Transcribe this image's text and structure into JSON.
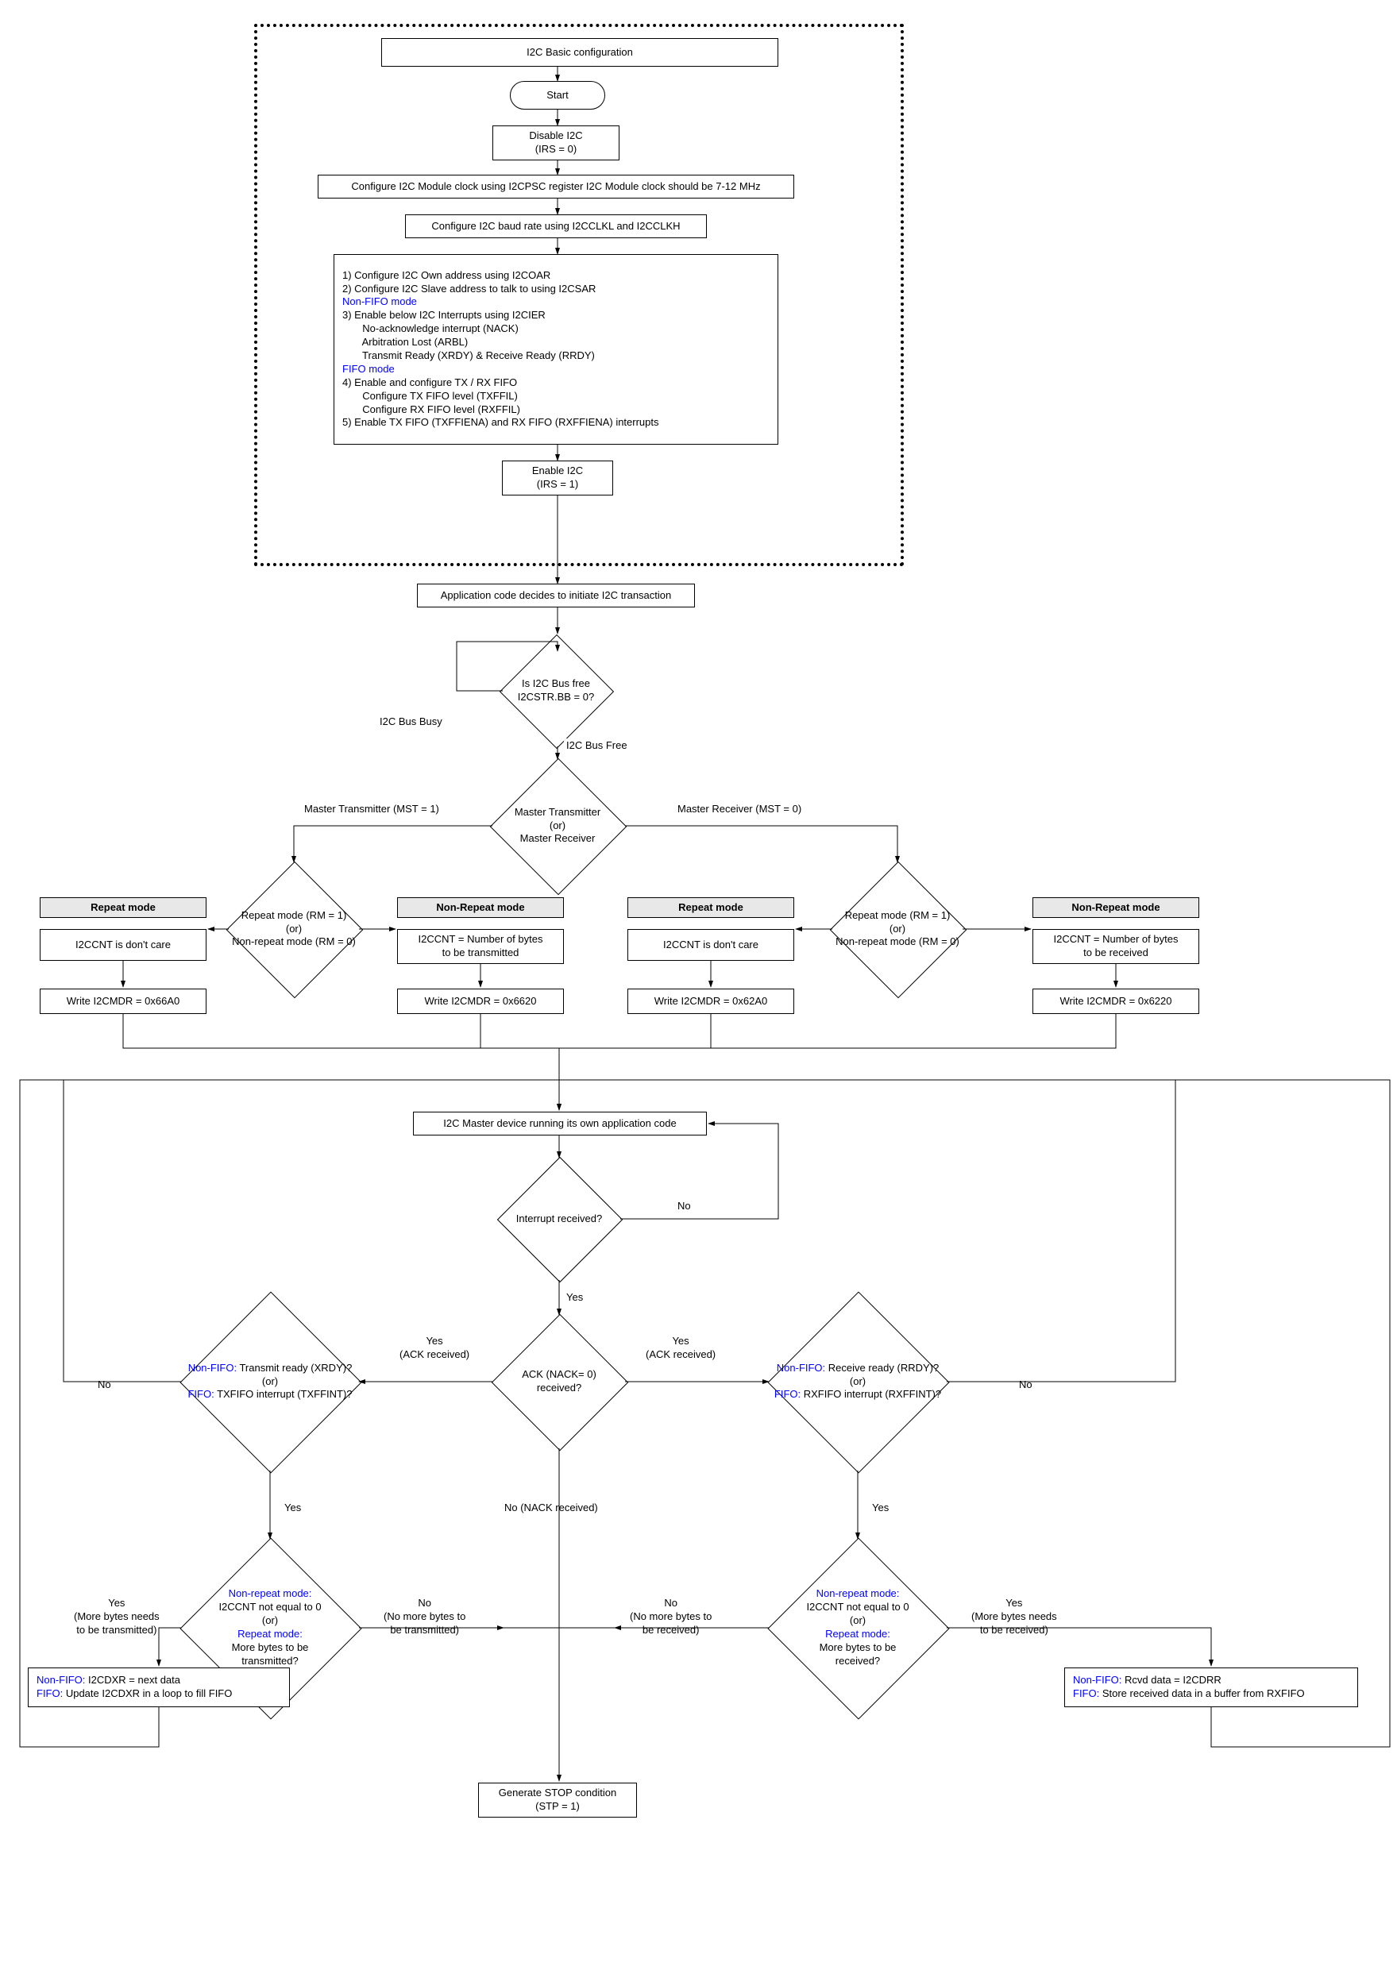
{
  "title": "I2C Basic configuration",
  "start": "Start",
  "disable_i2c": "Disable I2C\n(IRS = 0)",
  "config_clock": "Configure I2C Module clock using I2CPSC register I2C Module clock should be 7-12 MHz",
  "config_baud": "Configure I2C baud rate using I2CCLKL and I2CCLKH",
  "config_block": {
    "l1": "1) Configure I2C Own address using I2COAR",
    "l2": "2) Configure I2C Slave address to talk to using I2CSAR",
    "nf": "Non-FIFO mode",
    "l3": "3) Enable below I2C Interrupts using I2CIER",
    "l3a": "       No-acknowledge interrupt (NACK)",
    "l3b": "       Arbitration Lost (ARBL)",
    "l3c": "       Transmit Ready (XRDY) & Receive Ready (RRDY)",
    "ff": "FIFO mode",
    "l4": "4) Enable and configure TX / RX FIFO",
    "l4a": "       Configure TX FIFO level (TXFFIL)",
    "l4b": "       Configure RX FIFO level (RXFFIL)",
    "l5": "5) Enable TX FIFO (TXFFIENA) and RX FIFO (RXFFIENA) interrupts"
  },
  "enable_i2c": "Enable I2C\n(IRS = 1)",
  "app_decides": "Application code decides to  initiate I2C transaction",
  "bus_free_q": "Is I2C Bus free\nI2CSTR.BB = 0?",
  "bus_busy": "I2C Bus Busy",
  "bus_free": "I2C Bus Free",
  "mst_q": "Master Transmitter\n(or)\nMaster Receiver",
  "mst_tx": "Master Transmitter (MST = 1)",
  "mst_rx": "Master Receiver (MST = 0)",
  "rm_q": "Repeat mode (RM = 1)\n(or)\nNon-repeat mode (RM = 0)",
  "repeat_hdr": "Repeat mode",
  "nonrepeat_hdr": "Non-Repeat mode",
  "i2ccnt_dc": "I2CCNT is don't care",
  "i2ccnt_tx": "I2CCNT = Number of bytes\nto be transmitted",
  "i2ccnt_rx": "I2CCNT = Number of bytes\nto be received",
  "mdr_66A0": "Write I2CMDR = 0x66A0",
  "mdr_6620": "Write I2CMDR = 0x6620",
  "mdr_62A0": "Write I2CMDR = 0x62A0",
  "mdr_6220": "Write I2CMDR = 0x6220",
  "master_running": "I2C Master device running its own application code",
  "irq_q": "Interrupt received?",
  "no": "No",
  "yes": "Yes",
  "ack_q": "ACK (NACK= 0)\nreceived?",
  "yes_ack": "Yes\n(ACK received)",
  "no_nack": "No (NACK received)",
  "xrdy_q_nf": "Non-FIFO:",
  "xrdy_q_nf2": " Transmit ready (XRDY)?",
  "or": "(or)",
  "xrdy_q_ff": "FIFO:",
  "xrdy_q_ff2": " TXFIFO interrupt (TXFFINT)?",
  "rrdy_q_nf2": " Receive ready (RRDY)?",
  "rrdy_q_ff2": " RXFIFO interrupt (RXFFINT)?",
  "more_tx_nr": "Non-repeat mode:",
  "more_tx_nr2": "I2CCNT not equal to 0",
  "more_tx_rm": "Repeat mode:",
  "more_tx_rm2": "More bytes to be\ntransmitted?",
  "more_rx_rm2": "More bytes to be\nreceived?",
  "yes_more_tx": "Yes\n(More bytes needs\nto be transmitted)",
  "no_more_tx": "No\n(No more bytes to\nbe transmitted)",
  "yes_more_rx": "Yes\n(More bytes needs\nto be received)",
  "no_more_rx": "No\n(No more bytes to\nbe received)",
  "tx_action_nf": "Non-FIFO:",
  "tx_action_nf2": " I2CDXR = next data",
  "tx_action_ff": "FIFO:",
  "tx_action_ff2": " Update I2CDXR in a loop to fill FIFO",
  "rx_action_nf2": " Rcvd data = I2CDRR",
  "rx_action_ff2": " Store received data in a buffer from RXFIFO",
  "stop": "Generate STOP condition\n(STP = 1)",
  "chart_data": {
    "type": "flowchart",
    "nodes": [
      {
        "id": "title",
        "type": "process",
        "label": "I2C Basic configuration"
      },
      {
        "id": "start",
        "type": "terminator",
        "label": "Start"
      },
      {
        "id": "disable",
        "type": "process",
        "label": "Disable I2C (IRS = 0)"
      },
      {
        "id": "cfg_clock",
        "type": "process",
        "label": "Configure I2C Module clock using I2CPSC register I2C Module clock should be 7-12 MHz"
      },
      {
        "id": "cfg_baud",
        "type": "process",
        "label": "Configure I2C baud rate using I2CCLKL and I2CCLKH"
      },
      {
        "id": "cfg_block",
        "type": "process",
        "label": "1) Configure I2C Own address using I2COAR; 2) Configure I2C Slave address using I2CSAR; Non-FIFO mode: 3) Enable I2C Interrupts using I2CIER (NACK, ARBL, XRDY & RRDY); FIFO mode: 4) Enable and configure TX/RX FIFO (TXFFIL, RXFFIL); 5) Enable TX FIFO (TXFFIENA) and RX FIFO (RXFFIENA) interrupts"
      },
      {
        "id": "enable",
        "type": "process",
        "label": "Enable I2C (IRS = 1)"
      },
      {
        "id": "app",
        "type": "process",
        "label": "Application code decides to initiate I2C transaction"
      },
      {
        "id": "busfree",
        "type": "decision",
        "label": "Is I2C Bus free I2CSTR.BB = 0?"
      },
      {
        "id": "mst",
        "type": "decision",
        "label": "Master Transmitter (or) Master Receiver"
      },
      {
        "id": "rm_tx",
        "type": "decision",
        "label": "Repeat mode (RM = 1) (or) Non-repeat mode (RM = 0)"
      },
      {
        "id": "rm_rx",
        "type": "decision",
        "label": "Repeat mode (RM = 1) (or) Non-repeat mode (RM = 0)"
      },
      {
        "id": "tx_rep_cnt",
        "type": "process",
        "label": "I2CCNT is don't care"
      },
      {
        "id": "tx_nrep_cnt",
        "type": "process",
        "label": "I2CCNT = Number of bytes to be transmitted"
      },
      {
        "id": "rx_rep_cnt",
        "type": "process",
        "label": "I2CCNT is don't care"
      },
      {
        "id": "rx_nrep_cnt",
        "type": "process",
        "label": "I2CCNT = Number of bytes to be received"
      },
      {
        "id": "mdr66A0",
        "type": "process",
        "label": "Write I2CMDR = 0x66A0"
      },
      {
        "id": "mdr6620",
        "type": "process",
        "label": "Write I2CMDR = 0x6620"
      },
      {
        "id": "mdr62A0",
        "type": "process",
        "label": "Write I2CMDR = 0x62A0"
      },
      {
        "id": "mdr6220",
        "type": "process",
        "label": "Write I2CMDR = 0x6220"
      },
      {
        "id": "running",
        "type": "process",
        "label": "I2C Master device running its own application code"
      },
      {
        "id": "irq",
        "type": "decision",
        "label": "Interrupt received?"
      },
      {
        "id": "ack",
        "type": "decision",
        "label": "ACK (NACK= 0) received?"
      },
      {
        "id": "xrdy",
        "type": "decision",
        "label": "Non-FIFO: Transmit ready (XRDY)? (or) FIFO: TXFIFO interrupt (TXFFINT)?"
      },
      {
        "id": "rrdy",
        "type": "decision",
        "label": "Non-FIFO: Receive ready (RRDY)? (or) FIFO: RXFIFO interrupt (RXFFINT)?"
      },
      {
        "id": "more_tx",
        "type": "decision",
        "label": "Non-repeat mode: I2CCNT not equal to 0 (or) Repeat mode: More bytes to be transmitted?"
      },
      {
        "id": "more_rx",
        "type": "decision",
        "label": "Non-repeat mode: I2CCNT not equal to 0 (or) Repeat mode: More bytes to be received?"
      },
      {
        "id": "tx_action",
        "type": "process",
        "label": "Non-FIFO: I2CDXR = next data; FIFO: Update I2CDXR in a loop to fill FIFO"
      },
      {
        "id": "rx_action",
        "type": "process",
        "label": "Non-FIFO: Rcvd data = I2CDRR; FIFO: Store received data in a buffer from RXFIFO"
      },
      {
        "id": "stop",
        "type": "process",
        "label": "Generate STOP condition (STP = 1)"
      }
    ],
    "edges": [
      {
        "from": "start",
        "to": "disable"
      },
      {
        "from": "disable",
        "to": "cfg_clock"
      },
      {
        "from": "cfg_clock",
        "to": "cfg_baud"
      },
      {
        "from": "cfg_baud",
        "to": "cfg_block"
      },
      {
        "from": "cfg_block",
        "to": "enable"
      },
      {
        "from": "enable",
        "to": "app"
      },
      {
        "from": "app",
        "to": "busfree"
      },
      {
        "from": "busfree",
        "to": "busfree",
        "label": "I2C Bus Busy"
      },
      {
        "from": "busfree",
        "to": "mst",
        "label": "I2C Bus Free"
      },
      {
        "from": "mst",
        "to": "rm_tx",
        "label": "Master Transmitter (MST = 1)"
      },
      {
        "from": "mst",
        "to": "rm_rx",
        "label": "Master Receiver (MST = 0)"
      },
      {
        "from": "rm_tx",
        "to": "tx_rep_cnt",
        "label": "Repeat mode"
      },
      {
        "from": "rm_tx",
        "to": "tx_nrep_cnt",
        "label": "Non-Repeat mode"
      },
      {
        "from": "rm_rx",
        "to": "rx_rep_cnt",
        "label": "Repeat mode"
      },
      {
        "from": "rm_rx",
        "to": "rx_nrep_cnt",
        "label": "Non-Repeat mode"
      },
      {
        "from": "tx_rep_cnt",
        "to": "mdr66A0"
      },
      {
        "from": "tx_nrep_cnt",
        "to": "mdr6620"
      },
      {
        "from": "rx_rep_cnt",
        "to": "mdr62A0"
      },
      {
        "from": "rx_nrep_cnt",
        "to": "mdr6220"
      },
      {
        "from": "mdr66A0",
        "to": "running"
      },
      {
        "from": "mdr6620",
        "to": "running"
      },
      {
        "from": "mdr62A0",
        "to": "running"
      },
      {
        "from": "mdr6220",
        "to": "running"
      },
      {
        "from": "running",
        "to": "irq"
      },
      {
        "from": "irq",
        "to": "running",
        "label": "No"
      },
      {
        "from": "irq",
        "to": "ack",
        "label": "Yes"
      },
      {
        "from": "ack",
        "to": "xrdy",
        "label": "Yes (ACK received)"
      },
      {
        "from": "ack",
        "to": "rrdy",
        "label": "Yes (ACK received)"
      },
      {
        "from": "ack",
        "to": "stop",
        "label": "No (NACK received)"
      },
      {
        "from": "xrdy",
        "to": "more_tx",
        "label": "Yes"
      },
      {
        "from": "xrdy",
        "to": "running",
        "label": "No"
      },
      {
        "from": "rrdy",
        "to": "more_rx",
        "label": "Yes"
      },
      {
        "from": "rrdy",
        "to": "running",
        "label": "No"
      },
      {
        "from": "more_tx",
        "to": "tx_action",
        "label": "Yes (More bytes needs to be transmitted)"
      },
      {
        "from": "more_tx",
        "to": "stop",
        "label": "No (No more bytes to be transmitted)"
      },
      {
        "from": "more_rx",
        "to": "rx_action",
        "label": "Yes (More bytes needs to be received)"
      },
      {
        "from": "more_rx",
        "to": "stop",
        "label": "No (No more bytes to be received)"
      },
      {
        "from": "tx_action",
        "to": "running"
      },
      {
        "from": "rx_action",
        "to": "running"
      }
    ]
  }
}
